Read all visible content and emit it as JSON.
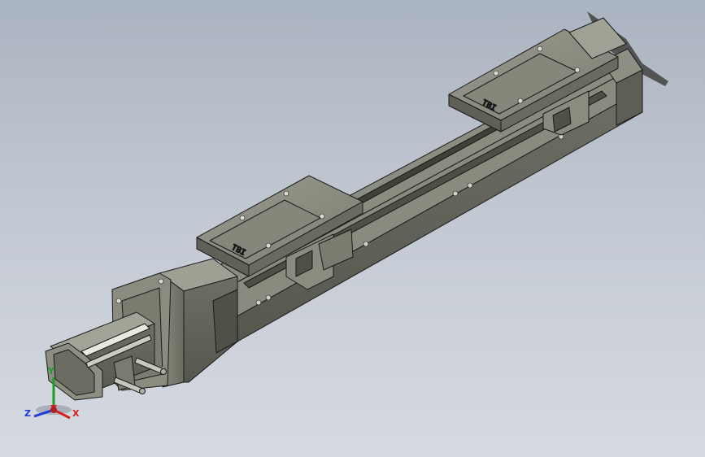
{
  "viewport": {
    "background_top": "#aab3c0",
    "background_bottom": "#d6dae1"
  },
  "model": {
    "name": "linear-actuator-module",
    "body_color": "#7a7b70",
    "edge_color": "#1a1a1a",
    "carriage_count": 2
  },
  "triad": {
    "x_label": "X",
    "y_label": "Y",
    "z_label": "Z",
    "x_color": "#d81e1e",
    "y_color": "#1e9a2a",
    "z_color": "#1e3ad8"
  }
}
